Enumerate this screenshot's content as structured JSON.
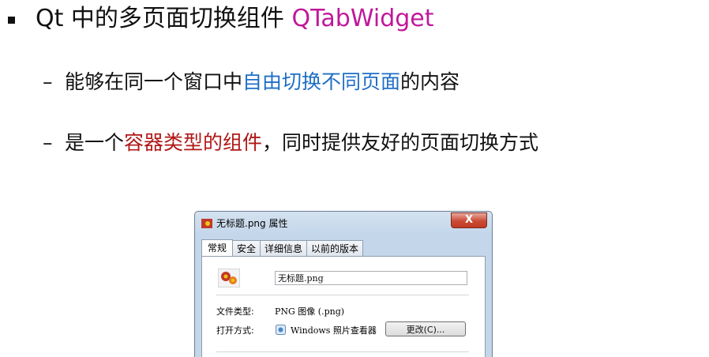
{
  "slide": {
    "title_plain": "Qt 中的多页面切换组件 ",
    "title_highlight": "QTabWidget",
    "point1": {
      "pre": "能够在同一个窗口中",
      "highlight": "自由切换不同页面",
      "post": "的内容"
    },
    "point2": {
      "pre": "是一个",
      "highlight": "容器类型的组件",
      "post": "，同时提供友好的页面切换方式"
    },
    "dash": "–",
    "colors": {
      "magenta": "#c0189b",
      "blue": "#1f6fc5",
      "red": "#b01818"
    }
  },
  "dialog": {
    "title": "无标题.png 属性",
    "close_label": "X",
    "tabs": [
      "常规",
      "安全",
      "详细信息",
      "以前的版本"
    ],
    "file_name": "无标题.png",
    "file_type_label": "文件类型:",
    "file_type_value": "PNG 图像 (.png)",
    "open_with_label": "打开方式:",
    "open_with_value": "Windows 照片查看器",
    "change_button": "更改(C)..."
  }
}
